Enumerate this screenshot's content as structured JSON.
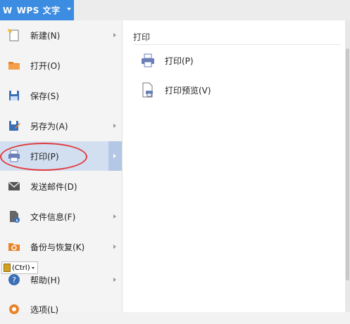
{
  "topbar": {
    "logo": "W",
    "title": "WPS 文字"
  },
  "menu": {
    "items": [
      {
        "label": "新建(N)",
        "icon": "new-doc-icon",
        "arrow": true
      },
      {
        "label": "打开(O)",
        "icon": "folder-open-icon",
        "arrow": false
      },
      {
        "label": "保存(S)",
        "icon": "save-icon",
        "arrow": false
      },
      {
        "label": "另存为(A)",
        "icon": "save-as-icon",
        "arrow": true
      },
      {
        "label": "打印(P)",
        "icon": "printer-icon",
        "arrow": true,
        "selected": true
      },
      {
        "label": "发送邮件(D)",
        "icon": "mail-icon",
        "arrow": false
      },
      {
        "label": "文件信息(F)",
        "icon": "file-info-icon",
        "arrow": true
      },
      {
        "label": "备份与恢复(K)",
        "icon": "backup-icon",
        "arrow": true
      },
      {
        "label": "帮助(H)",
        "icon": "help-icon",
        "arrow": true
      },
      {
        "label": "选项(L)",
        "icon": "gear-icon",
        "arrow": false
      }
    ]
  },
  "panel": {
    "title": "打印",
    "items": [
      {
        "label": "打印(P)",
        "icon": "printer-icon"
      },
      {
        "label": "打印预览(V)",
        "icon": "print-preview-icon"
      }
    ]
  },
  "ctrl_tag": {
    "label": "(Ctrl)"
  },
  "colors": {
    "accent": "#3c8ce1",
    "selected": "#d2dff1",
    "highlight_circle": "#e03b3b"
  }
}
